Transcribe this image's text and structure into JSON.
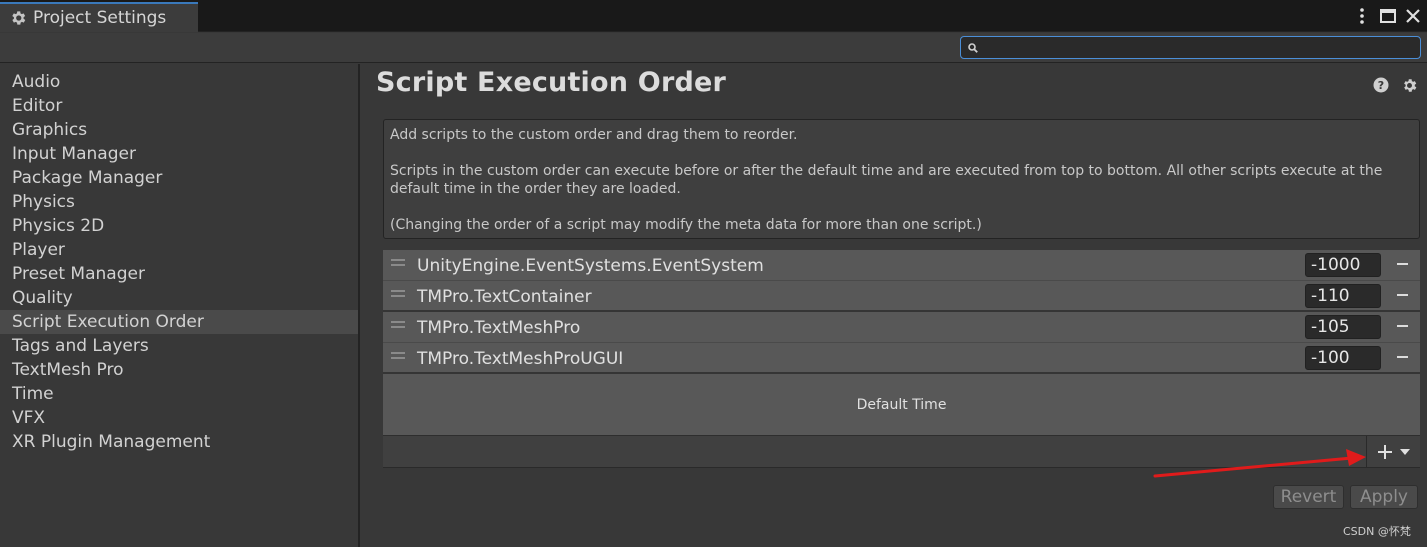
{
  "window": {
    "tab_title": "Project Settings"
  },
  "search": {
    "value": "",
    "placeholder": ""
  },
  "sidebar": {
    "items": [
      {
        "label": "Audio"
      },
      {
        "label": "Editor"
      },
      {
        "label": "Graphics"
      },
      {
        "label": "Input Manager"
      },
      {
        "label": "Package Manager"
      },
      {
        "label": "Physics"
      },
      {
        "label": "Physics 2D"
      },
      {
        "label": "Player"
      },
      {
        "label": "Preset Manager"
      },
      {
        "label": "Quality"
      },
      {
        "label": "Script Execution Order"
      },
      {
        "label": "Tags and Layers"
      },
      {
        "label": "TextMesh Pro"
      },
      {
        "label": "Time"
      },
      {
        "label": "VFX"
      },
      {
        "label": "XR Plugin Management"
      }
    ],
    "selected": "Script Execution Order"
  },
  "main": {
    "title": "Script Execution Order",
    "help": {
      "line1": "Add scripts to the custom order and drag them to reorder.",
      "line2": "Scripts in the custom order can execute before or after the default time and are executed from top to bottom. All other scripts execute at the default time in the order they are loaded.",
      "line3": "(Changing the order of a script may modify the meta data for more than one script.)"
    },
    "scripts": [
      {
        "name": "UnityEngine.EventSystems.EventSystem",
        "order": "-1000"
      },
      {
        "name": "TMPro.TextContainer",
        "order": "-110"
      },
      {
        "name": "TMPro.TextMeshPro",
        "order": "-105"
      },
      {
        "name": "TMPro.TextMeshProUGUI",
        "order": "-100"
      }
    ],
    "default_time_label": "Default Time",
    "revert_label": "Revert",
    "apply_label": "Apply"
  },
  "watermark": "CSDN @怀梵",
  "colors": {
    "accent": "#4b8fd8",
    "annotation_arrow": "#e01b1b"
  }
}
